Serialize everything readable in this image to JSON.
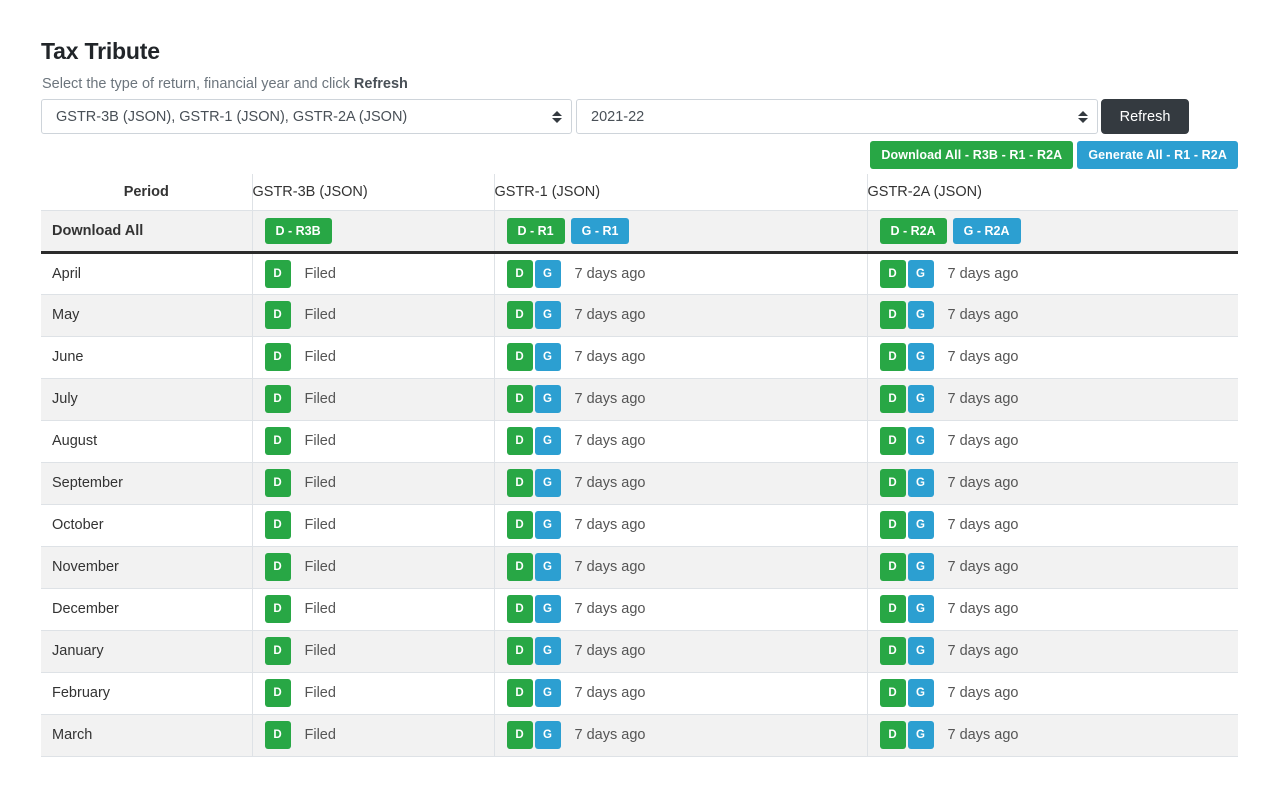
{
  "header": {
    "title": "Tax Tribute",
    "subtitle_prefix": "Select the type of return, financial year and click ",
    "subtitle_strong": "Refresh"
  },
  "controls": {
    "return_select_value": "GSTR-3B (JSON), GSTR-1 (JSON), GSTR-2A (JSON)",
    "year_select_value": "2021-22",
    "refresh_label": "Refresh",
    "download_all_label": "Download All - R3B - R1 - R2A",
    "generate_all_label": "Generate All - R1 - R2A"
  },
  "table": {
    "headers": {
      "period": "Period",
      "r3b": "GSTR-3B (JSON)",
      "r1": "GSTR-1 (JSON)",
      "r2a": "GSTR-2A (JSON)"
    },
    "bulk_row": {
      "label": "Download All",
      "r3b_download": "D - R3B",
      "r1_download": "D - R1",
      "r1_generate": "G - R1",
      "r2a_download": "D - R2A",
      "r2a_generate": "G - R2A"
    },
    "cell_labels": {
      "download": "D",
      "generate": "G"
    },
    "rows": [
      {
        "period": "April",
        "r3b_status": "Filed",
        "r1_status": "7 days ago",
        "r2a_status": "7 days ago"
      },
      {
        "period": "May",
        "r3b_status": "Filed",
        "r1_status": "7 days ago",
        "r2a_status": "7 days ago"
      },
      {
        "period": "June",
        "r3b_status": "Filed",
        "r1_status": "7 days ago",
        "r2a_status": "7 days ago"
      },
      {
        "period": "July",
        "r3b_status": "Filed",
        "r1_status": "7 days ago",
        "r2a_status": "7 days ago"
      },
      {
        "period": "August",
        "r3b_status": "Filed",
        "r1_status": "7 days ago",
        "r2a_status": "7 days ago"
      },
      {
        "period": "September",
        "r3b_status": "Filed",
        "r1_status": "7 days ago",
        "r2a_status": "7 days ago"
      },
      {
        "period": "October",
        "r3b_status": "Filed",
        "r1_status": "7 days ago",
        "r2a_status": "7 days ago"
      },
      {
        "period": "November",
        "r3b_status": "Filed",
        "r1_status": "7 days ago",
        "r2a_status": "7 days ago"
      },
      {
        "period": "December",
        "r3b_status": "Filed",
        "r1_status": "7 days ago",
        "r2a_status": "7 days ago"
      },
      {
        "period": "January",
        "r3b_status": "Filed",
        "r1_status": "7 days ago",
        "r2a_status": "7 days ago"
      },
      {
        "period": "February",
        "r3b_status": "Filed",
        "r1_status": "7 days ago",
        "r2a_status": "7 days ago"
      },
      {
        "period": "March",
        "r3b_status": "Filed",
        "r1_status": "7 days ago",
        "r2a_status": "7 days ago"
      }
    ]
  },
  "colors": {
    "green": "#28a745",
    "blue": "#2c9fd1",
    "dark": "#343a40",
    "row_alt": "#f2f2f2"
  }
}
